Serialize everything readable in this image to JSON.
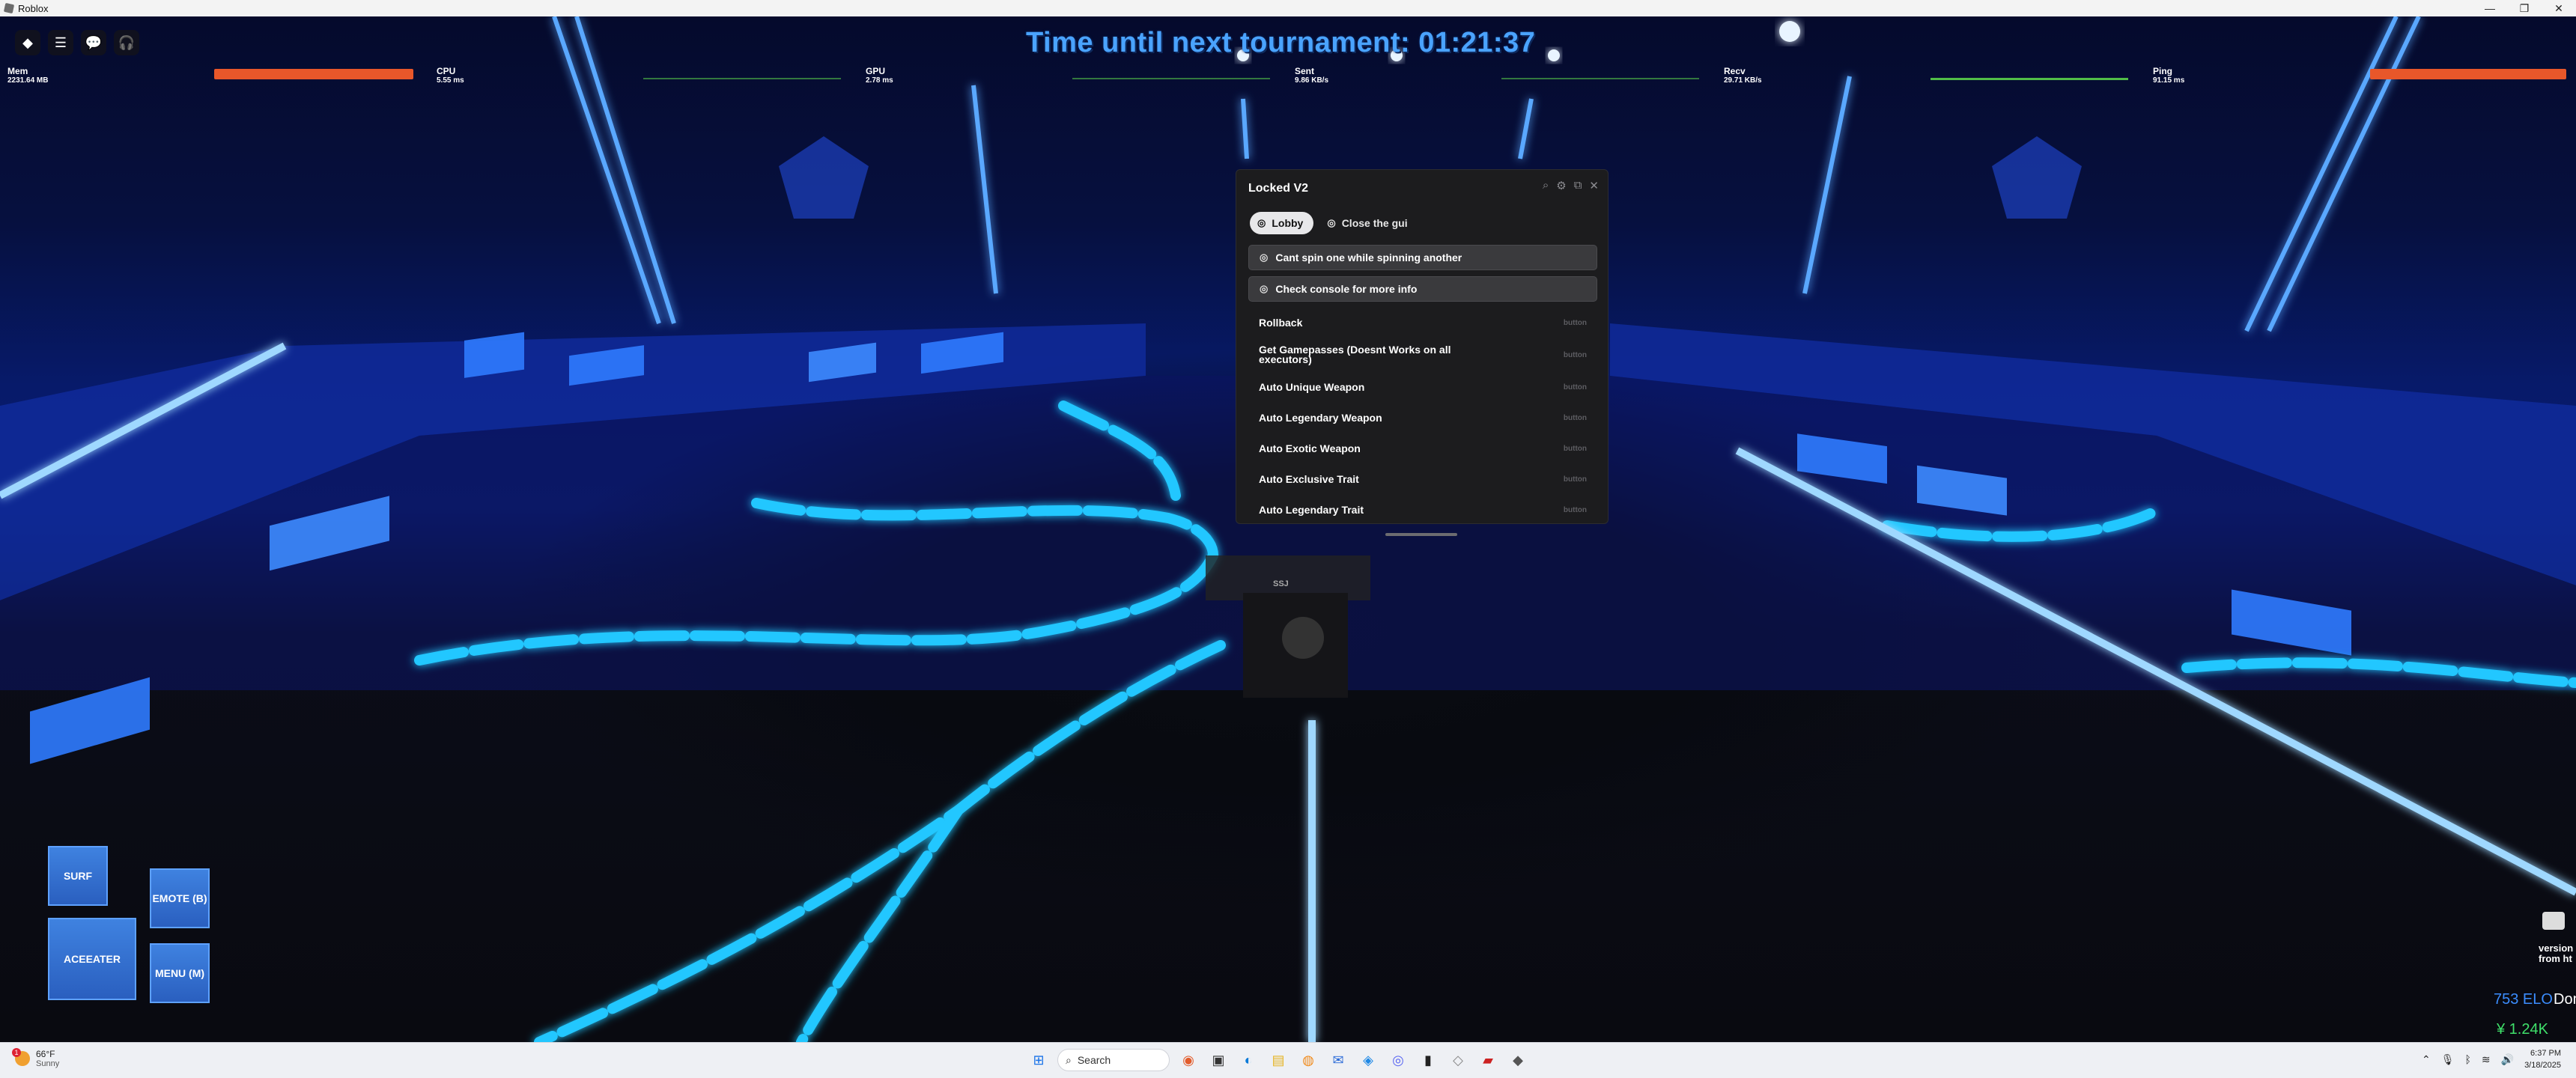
{
  "window": {
    "title": "Roblox",
    "controls": [
      "—",
      "❐",
      "✕"
    ]
  },
  "hud": {
    "tournament": "Time until next tournament: 01:21:37",
    "stats": [
      {
        "label": "Mem",
        "value": "2231.64 MB",
        "bar_color": "#e8572a"
      },
      {
        "label": "CPU",
        "value": "5.55 ms",
        "bar_color": "#5ad04a"
      },
      {
        "label": "GPU",
        "value": "2.78 ms",
        "bar_color": "#5ad04a"
      },
      {
        "label": "Sent",
        "value": "9.86 KB/s",
        "bar_color": "#5ad04a"
      },
      {
        "label": "Recv",
        "value": "29.71 KB/s",
        "bar_color": "#5ad04a"
      },
      {
        "label": "Ping",
        "value": "91.15 ms",
        "bar_color": "#e8572a"
      }
    ]
  },
  "gui": {
    "title": "Locked V2",
    "tabs": [
      {
        "label": "Lobby",
        "active": true
      },
      {
        "label": "Close the gui",
        "active": false
      }
    ],
    "notes": [
      "Cant spin one while spinning another",
      "Check console for more info"
    ],
    "buttons": [
      {
        "label": "Rollback",
        "kind": "button"
      },
      {
        "label": "Get Gamepasses (Doesnt Works on all executors)",
        "kind": "button"
      },
      {
        "label": "Auto Unique Weapon",
        "kind": "button"
      },
      {
        "label": "Auto Legendary Weapon",
        "kind": "button"
      },
      {
        "label": "Auto Exotic Weapon",
        "kind": "button"
      },
      {
        "label": "Auto Exclusive Trait",
        "kind": "button"
      },
      {
        "label": "Auto Legendary Trait",
        "kind": "button"
      }
    ]
  },
  "player_tag": "SSJ",
  "mobile_buttons": {
    "surf": "SURF",
    "emote": "EMOTE (B)",
    "aceeater": "ACEEATER",
    "menu": "MENU (M)"
  },
  "right_info": {
    "version": "version",
    "from": "from ht",
    "elo": "753 ELO",
    "don": "Don",
    "yen": "¥ 1.24K"
  },
  "taskbar": {
    "weather_temp": "66°F",
    "weather_desc": "Sunny",
    "weather_badge": "1",
    "search_placeholder": "Search",
    "time": "6:37 PM",
    "date": "3/18/2025"
  },
  "colors": {
    "neon": "#1aa0ff",
    "gui_bg": "#1c1c1e",
    "tournament": "#4aa3ff"
  }
}
